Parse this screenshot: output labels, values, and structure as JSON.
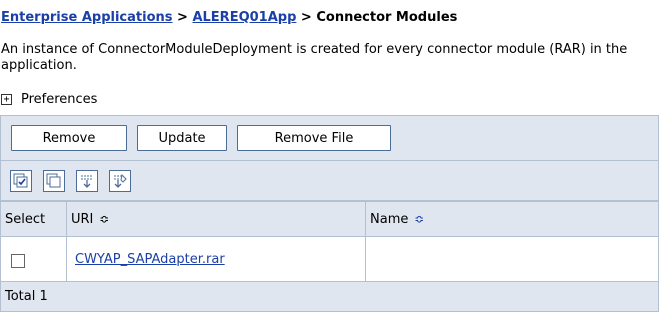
{
  "breadcrumb": {
    "crumb1": "Enterprise Applications",
    "sep1": " > ",
    "crumb2": "ALEREQ01App",
    "sep2": " > ",
    "current": "Connector Modules"
  },
  "description": "An instance of ConnectorModuleDeployment is created for every connector module (RAR) in the application.",
  "preferences": {
    "expander": "+",
    "label": "Preferences"
  },
  "buttons": {
    "remove": "Remove",
    "update": "Update",
    "remove_file": "Remove File"
  },
  "icons": [
    "select-all-icon",
    "deselect-all-icon",
    "show-filter-icon",
    "clear-filter-icon"
  ],
  "table": {
    "headers": {
      "select": "Select",
      "uri": "URI",
      "name": "Name"
    },
    "rows": [
      {
        "uri": "CWYAP_SAPAdapter.rar",
        "name": ""
      }
    ],
    "total_label": "Total 1"
  },
  "colors": {
    "link": "#1a3fa8",
    "toolbar_bg": "#dfe6ef",
    "border": "#b3c0d2"
  }
}
